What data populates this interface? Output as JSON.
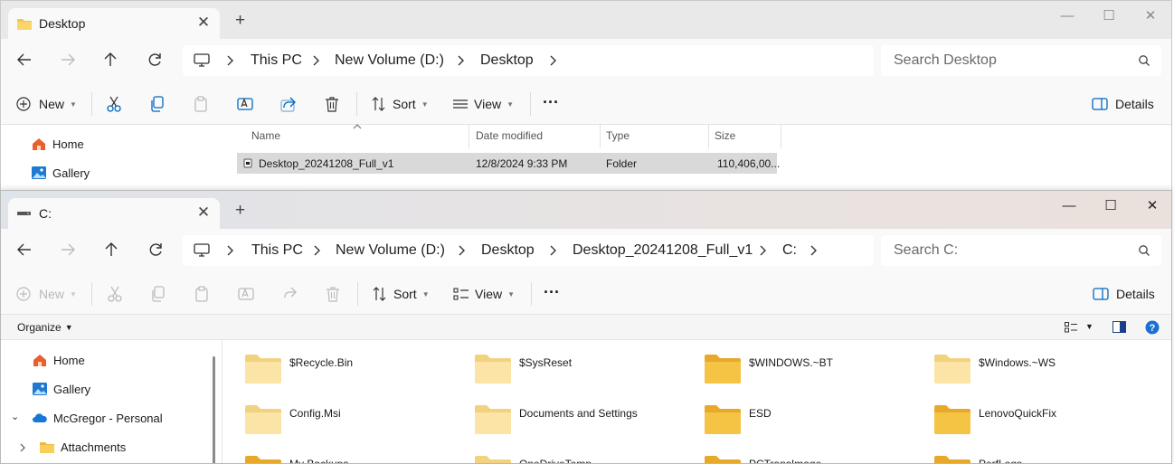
{
  "back_window": {
    "tab_title": "Desktop",
    "tab_close": "✕",
    "new_tab": "+",
    "controls": {
      "minimize": "—",
      "maximize": "☐",
      "close": "✕"
    },
    "breadcrumbs": [
      "This PC",
      "New Volume (D:)",
      "Desktop"
    ],
    "search_placeholder": "Search Desktop",
    "toolbar": {
      "new": "New",
      "sort": "Sort",
      "view": "View",
      "more": "···",
      "details": "Details"
    },
    "nav": [
      "Home",
      "Gallery"
    ],
    "columns": {
      "name": "Name",
      "date": "Date modified",
      "type": "Type",
      "size": "Size"
    },
    "rows": [
      {
        "name": "Desktop_20241208_Full_v1",
        "date": "12/8/2024 9:33 PM",
        "type": "Folder",
        "size": "110,406,00..."
      }
    ]
  },
  "front_window": {
    "tab_title": "C:",
    "tab_close": "✕",
    "new_tab": "+",
    "controls": {
      "minimize": "—",
      "maximize": "☐",
      "close": "✕"
    },
    "breadcrumbs": [
      "This PC",
      "New Volume (D:)",
      "Desktop",
      "Desktop_20241208_Full_v1",
      "C:"
    ],
    "search_placeholder": "Search C:",
    "toolbar": {
      "new": "New",
      "sort": "Sort",
      "view": "View",
      "more": "···",
      "details": "Details"
    },
    "organize": "Organize",
    "nav": [
      "Home",
      "Gallery",
      "McGregor - Personal",
      "Attachments"
    ],
    "folders": [
      {
        "name": "$Recycle.Bin",
        "style": "faded"
      },
      {
        "name": "$SysReset",
        "style": "faded"
      },
      {
        "name": "$WINDOWS.~BT",
        "style": "solid"
      },
      {
        "name": "$Windows.~WS",
        "style": "faded"
      },
      {
        "name": "Config.Msi",
        "style": "faded"
      },
      {
        "name": "Documents and Settings",
        "style": "faded"
      },
      {
        "name": "ESD",
        "style": "solid"
      },
      {
        "name": "LenovoQuickFix",
        "style": "solid"
      },
      {
        "name": "My Backups",
        "style": "solid"
      },
      {
        "name": "OneDriveTemp",
        "style": "faded"
      },
      {
        "name": "PCTransImage",
        "style": "solid"
      },
      {
        "name": "PerfLogs",
        "style": "solid"
      }
    ]
  },
  "colors": {
    "accent": "#0067c0",
    "folder": "#f6c445",
    "folder_faded": "#fbe4a6"
  }
}
